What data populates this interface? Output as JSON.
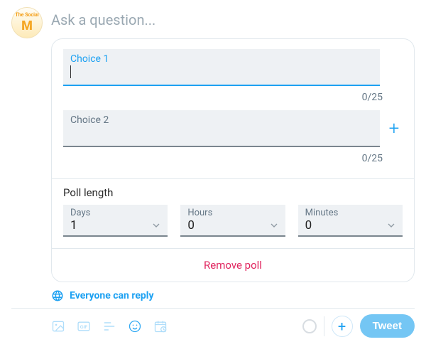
{
  "avatar": {
    "line1": "The Social",
    "line2": "M"
  },
  "question_placeholder": "Ask a question...",
  "poll": {
    "choices": [
      {
        "label": "Choice 1",
        "value": "",
        "count": "0/25",
        "focused": true
      },
      {
        "label": "Choice 2",
        "value": "",
        "count": "0/25",
        "focused": false
      }
    ],
    "add_choice_label": "+",
    "length_title": "Poll length",
    "length": {
      "days": {
        "label": "Days",
        "value": "1"
      },
      "hours": {
        "label": "Hours",
        "value": "0"
      },
      "minutes": {
        "label": "Minutes",
        "value": "0"
      }
    },
    "remove_label": "Remove poll"
  },
  "reply": {
    "label": "Everyone can reply"
  },
  "toolbar": {
    "image_icon": "image-icon",
    "gif_label": "GIF",
    "poll_icon": "poll-icon",
    "emoji_icon": "emoji-icon",
    "schedule_icon": "schedule-icon",
    "add_thread_label": "+",
    "tweet_label": "Tweet"
  }
}
